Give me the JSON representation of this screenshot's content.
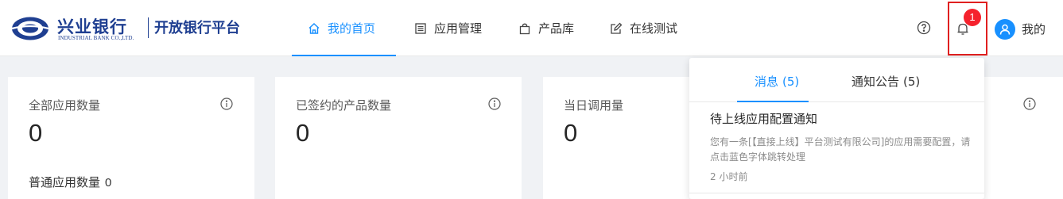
{
  "brand": {
    "name_cn": "兴业银行",
    "name_en": "INDUSTRIAL BANK CO.,LTD.",
    "platform": "开放银行平台",
    "color": "#1f3f91"
  },
  "nav": {
    "items": [
      {
        "label": "我的首页",
        "icon": "home-icon",
        "active": true
      },
      {
        "label": "应用管理",
        "icon": "app-list-icon",
        "active": false
      },
      {
        "label": "产品库",
        "icon": "bag-icon",
        "active": false
      },
      {
        "label": "在线测试",
        "icon": "edit-icon",
        "active": false
      }
    ],
    "accent": "#1890ff"
  },
  "header_right": {
    "help_icon": "question-circle-icon",
    "bell_icon": "bell-icon",
    "notification_count": "1",
    "avatar_icon": "user-icon",
    "user_label": "我的"
  },
  "cards": [
    {
      "title": "全部应用数量",
      "value": "0",
      "sub_label": "普通应用数量",
      "sub_value": "0"
    },
    {
      "title": "已签约的产品数量",
      "value": "0"
    },
    {
      "title": "当日调用量",
      "value": "0"
    }
  ],
  "notifications": {
    "tabs": [
      {
        "label": "消息",
        "count": "(5)",
        "active": true
      },
      {
        "label": "通知公告",
        "count": "(5)",
        "active": false
      }
    ],
    "messages": [
      {
        "title": "待上线应用配置通知",
        "body": "您有一条[【直接上线】平台测试有限公司]的应用需要配置，请点击蓝色字体跳转处理",
        "time": "2 小时前"
      }
    ]
  }
}
